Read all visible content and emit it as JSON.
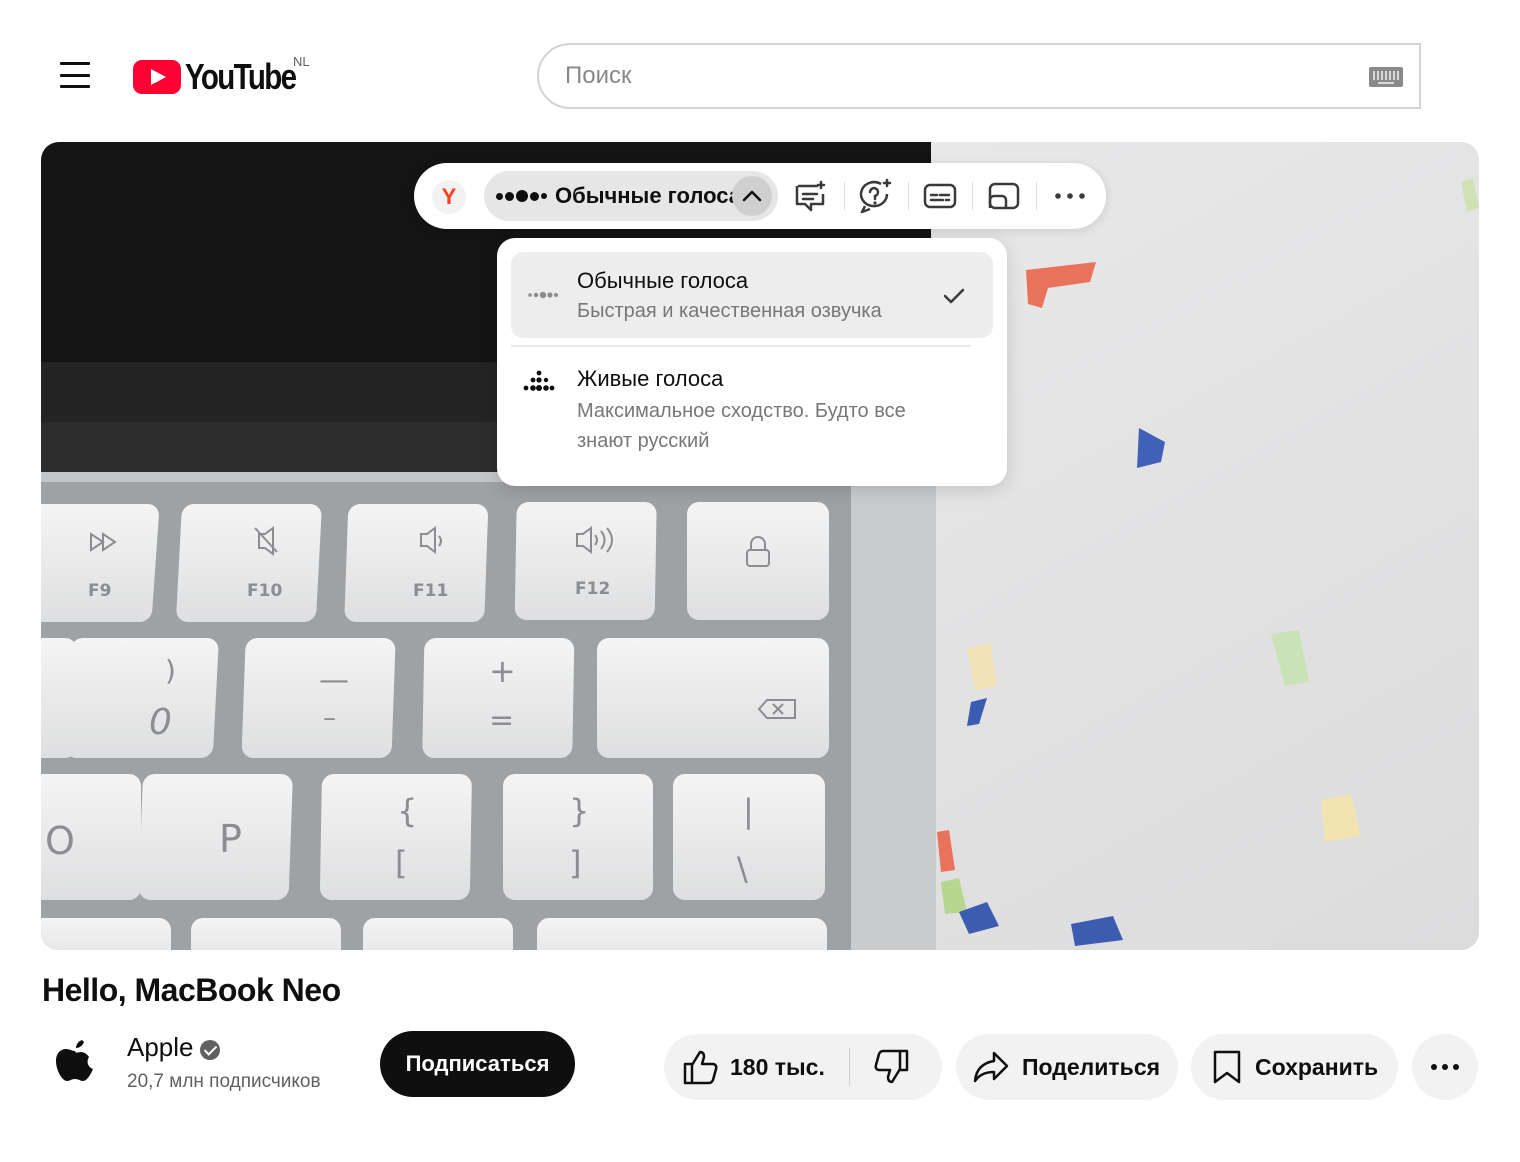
{
  "header": {
    "logo_text": "YouTube",
    "country_code": "NL",
    "search_placeholder": "Поиск"
  },
  "translator": {
    "logo_letter": "Y",
    "current_voice_label": "Обычные голоса",
    "toolbar_icons": [
      "subtitles-sparkle-icon",
      "question-sparkle-icon",
      "captions-icon",
      "picture-in-picture-icon",
      "more-icon"
    ],
    "options": [
      {
        "title": "Обычные голоса",
        "subtitle": "Быстрая и качественная озвучка",
        "selected": true
      },
      {
        "title": "Живые голоса",
        "subtitle": "Максимальное сходство. Будто все знают русский",
        "selected": false
      }
    ]
  },
  "video": {
    "title": "Hello, MacBook Neo",
    "channel": "Apple",
    "subscribers": "20,7 млн подписчиков",
    "subscribe_label": "Подписаться",
    "likes": "180 тыс.",
    "share_label": "Поделиться",
    "save_label": "Сохранить"
  },
  "frame_keys": {
    "fkeys": [
      "F9",
      "F10",
      "F11",
      "F12"
    ],
    "number_row": [
      ")",
      "0",
      "—",
      "–",
      "+",
      "="
    ],
    "letter_row": [
      "O",
      "P",
      "{",
      "[",
      "}",
      "]",
      "|",
      "\\"
    ]
  },
  "colors": {
    "brand_red": "#ff0033",
    "yandex_red": "#fc3f1d",
    "subscribe_bg": "#0f0f0f",
    "pill_bg": "#f2f2f2"
  }
}
